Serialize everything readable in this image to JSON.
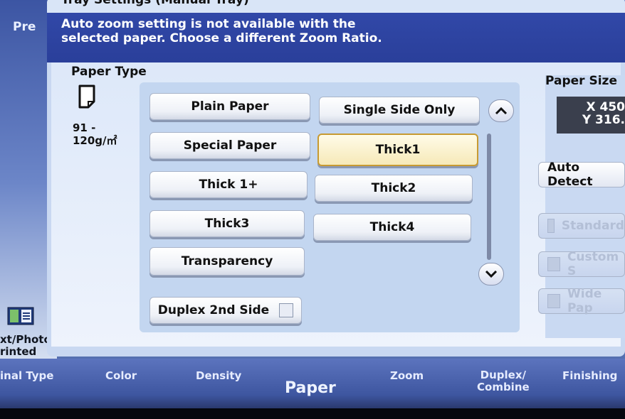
{
  "behind": {
    "preview_label": "Pre",
    "original_type_text": "xt/Photo\nrinted"
  },
  "dialog": {
    "title": "Tray Settings (Manual Tray)",
    "message_line1": "Auto zoom setting is not available with the",
    "message_line2": "selected paper. Choose a different Zoom Ratio."
  },
  "paper_type": {
    "label": "Paper Type",
    "weight_line1": "91 -",
    "weight_line2": "120g/㎡",
    "buttons": [
      {
        "label": "Plain Paper"
      },
      {
        "label": "Single Side Only"
      },
      {
        "label": "Special Paper"
      },
      {
        "label": "Thick1",
        "selected": true
      },
      {
        "label": "Thick 1+"
      },
      {
        "label": "Thick2"
      },
      {
        "label": "Thick3"
      },
      {
        "label": "Thick4"
      },
      {
        "label": "Transparency"
      }
    ],
    "duplex_label": "Duplex 2nd Side"
  },
  "paper_size": {
    "label": "Paper Size",
    "x_value": "X 450",
    "y_value": "Y 316.",
    "auto_detect": "Auto Detect",
    "options": [
      {
        "label": "Standard",
        "disabled": true
      },
      {
        "label": "Custom S",
        "disabled": true
      },
      {
        "label": "Wide Pap",
        "disabled": true
      }
    ]
  },
  "tabs": [
    {
      "label": "inal Type"
    },
    {
      "label": "Color"
    },
    {
      "label": "Density"
    },
    {
      "label": "Paper",
      "active": true
    },
    {
      "label": "Zoom"
    },
    {
      "label": "Duplex/\nCombine"
    },
    {
      "label": "Finishing"
    }
  ],
  "colors": {
    "message_bg": "#2f46a6",
    "selected_border": "#c79a32"
  }
}
